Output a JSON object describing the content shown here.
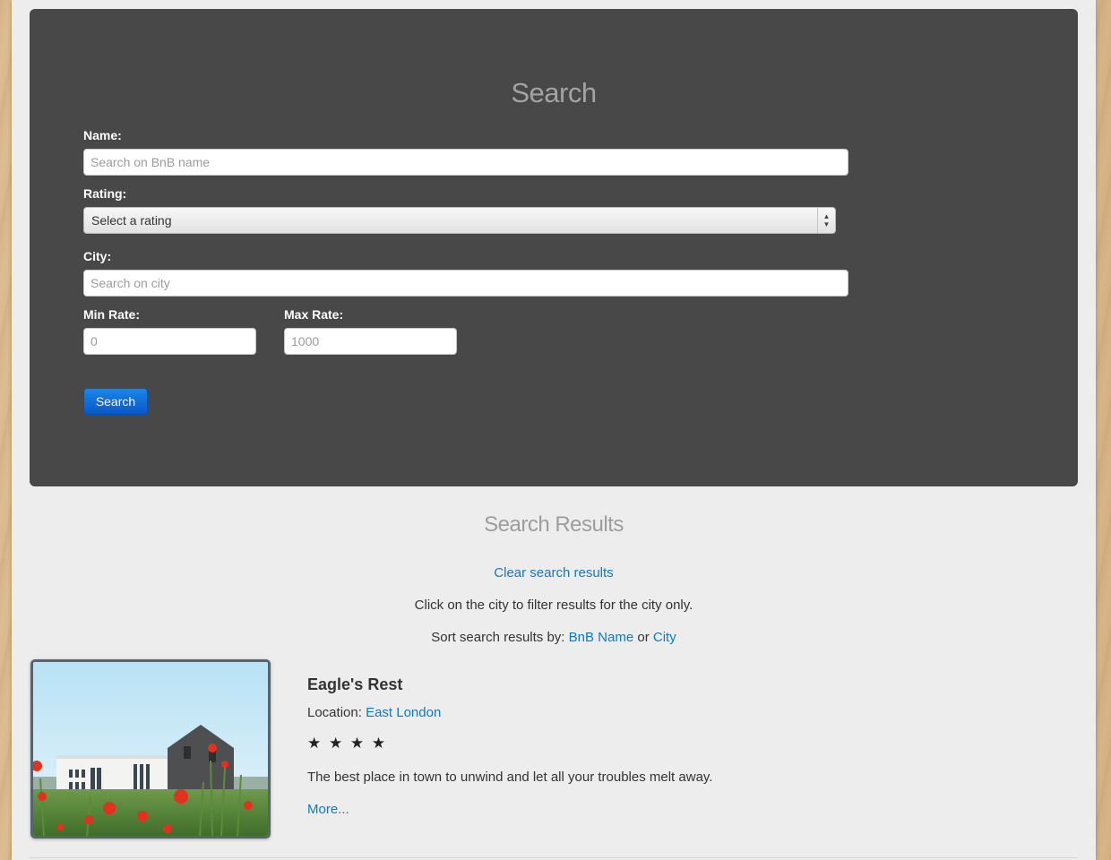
{
  "search": {
    "title": "Search",
    "name_label": "Name:",
    "name_placeholder": "Search on BnB name",
    "rating_label": "Rating:",
    "rating_selected": "Select a rating",
    "city_label": "City:",
    "city_placeholder": "Search on city",
    "min_label": "Min Rate:",
    "min_placeholder": "0",
    "max_label": "Max Rate:",
    "max_placeholder": "1000",
    "button_label": "Search"
  },
  "results": {
    "title": "Search Results",
    "clear_link": "Clear search results",
    "hint": "Click on the city to filter results for the city only.",
    "sort_prefix": "Sort search results by:",
    "sort_name": "BnB Name",
    "sort_or": "or",
    "sort_city": "City",
    "items": [
      {
        "name": "Eagle's Rest",
        "location_label": "Location:",
        "location": "East London",
        "stars": "★ ★ ★ ★",
        "description": "The best place in town to unwind and let all your troubles melt away.",
        "more_link": "More..."
      }
    ]
  },
  "colors": {
    "hero_bg": "#484848",
    "link": "#0e7ac4",
    "button": "#0a57c8",
    "page_bg": "#ededed"
  }
}
